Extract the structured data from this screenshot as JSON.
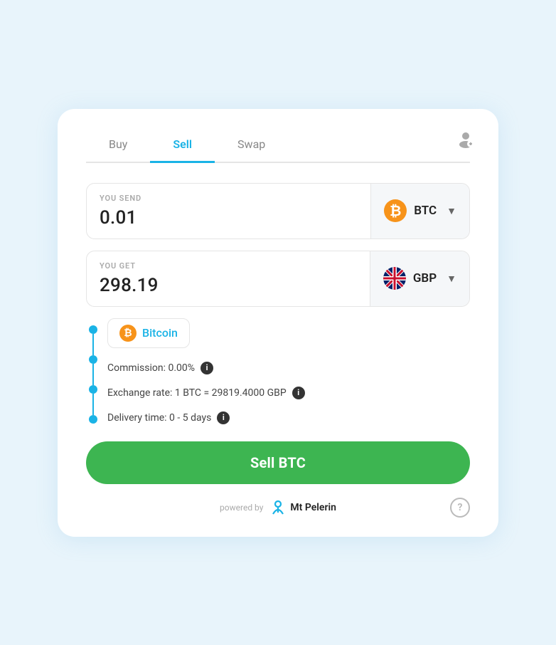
{
  "tabs": [
    {
      "label": "Buy",
      "active": false
    },
    {
      "label": "Sell",
      "active": true
    },
    {
      "label": "Swap",
      "active": false
    }
  ],
  "send": {
    "label": "YOU SEND",
    "value": "0.01",
    "currency": {
      "code": "BTC",
      "icon": "₿"
    }
  },
  "get": {
    "label": "YOU GET",
    "value": "298.19",
    "currency": {
      "code": "GBP"
    }
  },
  "bitcoin_dropdown": {
    "label": "Bitcoin"
  },
  "commission": {
    "label": "Commission: 0.00%"
  },
  "exchange_rate": {
    "label": "Exchange rate: 1 BTC = 29819.4000 GBP"
  },
  "delivery_time": {
    "label": "Delivery time: 0 - 5 days"
  },
  "sell_button": {
    "label": "Sell BTC"
  },
  "footer": {
    "powered_by": "powered by",
    "brand": "Mt\nPelerin"
  }
}
